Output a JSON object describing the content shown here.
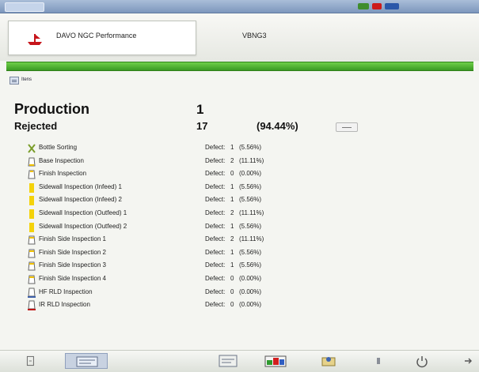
{
  "window": {
    "title": "",
    "status_text": "",
    "status_colors": [
      "#3f8d2e",
      "#cc1a1a",
      "#2a57a9"
    ]
  },
  "header": {
    "brand_name": "DAVO NGC Performance",
    "machine_id": "VBNG3",
    "status_bar_text": "",
    "logo_icon": "ship-icon"
  },
  "menu": {
    "label": "Itens",
    "icon": "menu-icon"
  },
  "summary": {
    "production_label": "Production",
    "production_value": "1",
    "rejected_label": "Rejected",
    "rejected_value": "17",
    "rejected_pct": "(94.44%)"
  },
  "inspections": [
    {
      "icon": "sorting-icon",
      "name": "Bottle Sorting",
      "defect_label": "Defect:",
      "count": "1",
      "pct": "(5.56%)"
    },
    {
      "icon": "base-inspection-icon",
      "name": "Base Inspection",
      "defect_label": "Defect:",
      "count": "2",
      "pct": "(11.11%)"
    },
    {
      "icon": "finish-inspection-icon",
      "name": "Finish Inspection",
      "defect_label": "Defect:",
      "count": "0",
      "pct": "(0.00%)"
    },
    {
      "icon": "sidewall-inspection-icon",
      "name": "Sidewall Inspection (Infeed) 1",
      "defect_label": "Defect:",
      "count": "1",
      "pct": "(5.56%)"
    },
    {
      "icon": "sidewall-inspection-icon",
      "name": "Sidewall Inspection (Infeed) 2",
      "defect_label": "Defect:",
      "count": "1",
      "pct": "(5.56%)"
    },
    {
      "icon": "sidewall-inspection-icon",
      "name": "Sidewall Inspection (Outfeed) 1",
      "defect_label": "Defect:",
      "count": "2",
      "pct": "(11.11%)"
    },
    {
      "icon": "sidewall-inspection-icon",
      "name": "Sidewall Inspection (Outfeed) 2",
      "defect_label": "Defect:",
      "count": "1",
      "pct": "(5.56%)"
    },
    {
      "icon": "finish-side-icon",
      "name": "Finish Side Inspection 1",
      "defect_label": "Defect:",
      "count": "2",
      "pct": "(11.11%)"
    },
    {
      "icon": "finish-side-icon",
      "name": "Finish Side Inspection 2",
      "defect_label": "Defect:",
      "count": "1",
      "pct": "(5.56%)"
    },
    {
      "icon": "finish-side-icon",
      "name": "Finish Side Inspection 3",
      "defect_label": "Defect:",
      "count": "1",
      "pct": "(5.56%)"
    },
    {
      "icon": "finish-side-icon",
      "name": "Finish Side Inspection 4",
      "defect_label": "Defect:",
      "count": "0",
      "pct": "(0.00%)"
    },
    {
      "icon": "hf-rlo-icon",
      "name": "HF RLD Inspection",
      "defect_label": "Defect:",
      "count": "0",
      "pct": "(0.00%)"
    },
    {
      "icon": "ir-rlo-icon",
      "name": "IR RLD Inspection",
      "defect_label": "Defect:",
      "count": "0",
      "pct": "(0.00%)"
    }
  ],
  "footer": {
    "buttons": [
      {
        "icon": "home-icon"
      },
      {
        "icon": "overview-icon"
      },
      {
        "icon": "statistics-icon"
      },
      {
        "icon": "production-chart-icon"
      },
      {
        "icon": "user-icon"
      },
      {
        "icon": "settings-icon"
      },
      {
        "icon": "power-icon"
      },
      {
        "icon": "exit-icon"
      }
    ]
  }
}
